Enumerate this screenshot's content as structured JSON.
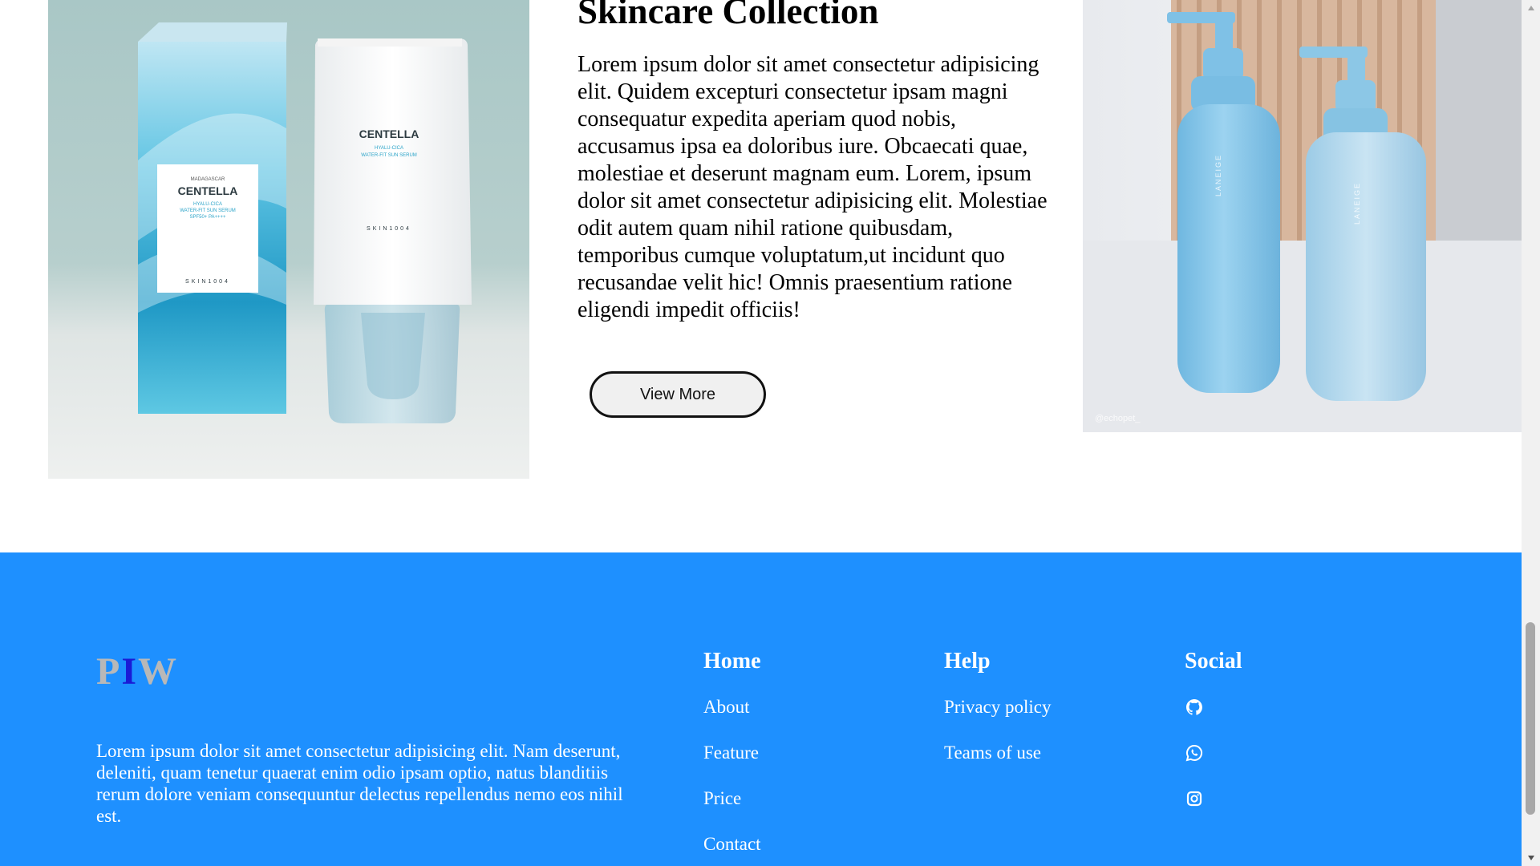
{
  "product": {
    "title": "Skincare Collection",
    "description": "Lorem ipsum dolor sit amet consectetur adipisicing elit. Quidem excepturi consectetur ipsam magni consequatur expedita aperiam quod nobis, accusamus ipsa ea doloribus iure. Obcaecati quae, molestiae et deserunt magnam eum. Lorem, ipsum dolor sit amet consectetur adipisicing elit. Molestiae odit autem quam nihil ratione quibusdam, temporibus cumque voluptatum,ut incidunt quo recusandae velit hic! Omnis praesentium ratione eligendi impedit officiis!",
    "button_label": "View More",
    "left_image": {
      "brand": "CENTELLA",
      "origin": "MADAGASCAR",
      "product_line": "HYALU-CICA",
      "product_name": "WATER-FIT SUN SERUM",
      "spf": "SPF50+ PA++++",
      "maker": "SKIN1004"
    },
    "right_image": {
      "brand": "LANEIGE",
      "watermark": "@echopet_"
    }
  },
  "footer": {
    "logo": {
      "p": "P",
      "i": "I",
      "w": "W"
    },
    "description": "Lorem ipsum dolor sit amet consectetur adipisicing elit. Nam deserunt, deleniti, quam tenetur quaerat enim odio ipsam optio, natus blanditiis rerum dolore veniam consequuntur delectus repellendus nemo eos nihil est.",
    "columns": {
      "home": {
        "heading": "Home",
        "links": [
          "About",
          "Feature",
          "Price",
          "Contact"
        ]
      },
      "help": {
        "heading": "Help",
        "links": [
          "Privacy policy",
          "Teams of use"
        ]
      },
      "social": {
        "heading": "Social",
        "icons": [
          "github-icon",
          "whatsapp-icon",
          "instagram-icon"
        ]
      }
    }
  },
  "colors": {
    "footer_bg": "#1e90ff",
    "logo_grey": "#b8b8b8",
    "logo_blue": "#1a1ad6"
  }
}
